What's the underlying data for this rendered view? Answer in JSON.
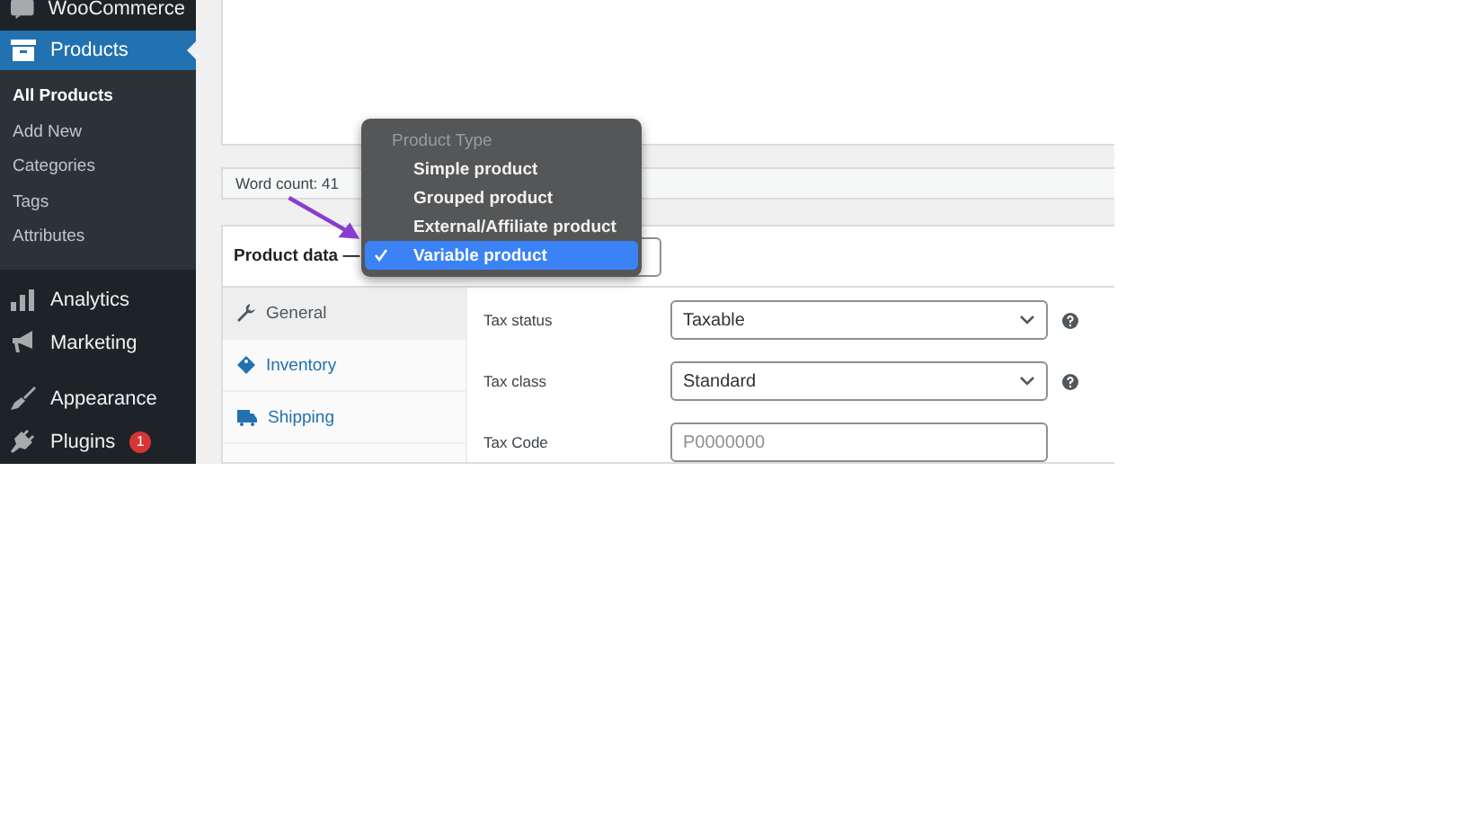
{
  "sidebar": {
    "items": [
      {
        "label": "WooCommerce",
        "selected": false
      },
      {
        "label": "Products",
        "selected": true,
        "children": [
          {
            "label": "All Products",
            "selected": true
          },
          {
            "label": "Add New",
            "selected": false
          },
          {
            "label": "Categories",
            "selected": false
          },
          {
            "label": "Tags",
            "selected": false
          },
          {
            "label": "Attributes",
            "selected": false
          }
        ]
      },
      {
        "label": "Analytics",
        "selected": false
      },
      {
        "label": "Marketing",
        "selected": false
      },
      {
        "label": "Appearance",
        "selected": false
      },
      {
        "label": "Plugins",
        "selected": false,
        "badge": "1"
      }
    ]
  },
  "editor": {
    "word_count": "Word count: 41"
  },
  "product_data": {
    "title": "Product data —",
    "tabs": [
      {
        "label": "General",
        "selected": true
      },
      {
        "label": "Inventory",
        "selected": false
      },
      {
        "label": "Shipping",
        "selected": false
      }
    ],
    "fields": [
      {
        "label": "Tax status",
        "kind": "select",
        "value": "Taxable",
        "help": true
      },
      {
        "label": "Tax class",
        "kind": "select",
        "value": "Standard",
        "help": true
      },
      {
        "label": "Tax Code",
        "kind": "text",
        "placeholder": "P0000000",
        "help": false
      }
    ]
  },
  "product_type_menu": {
    "header": "Product Type",
    "options": [
      {
        "label": "Simple product",
        "selected": false
      },
      {
        "label": "Grouped product",
        "selected": false
      },
      {
        "label": "External/Affiliate product",
        "selected": false
      },
      {
        "label": "Variable product",
        "selected": true
      }
    ]
  }
}
